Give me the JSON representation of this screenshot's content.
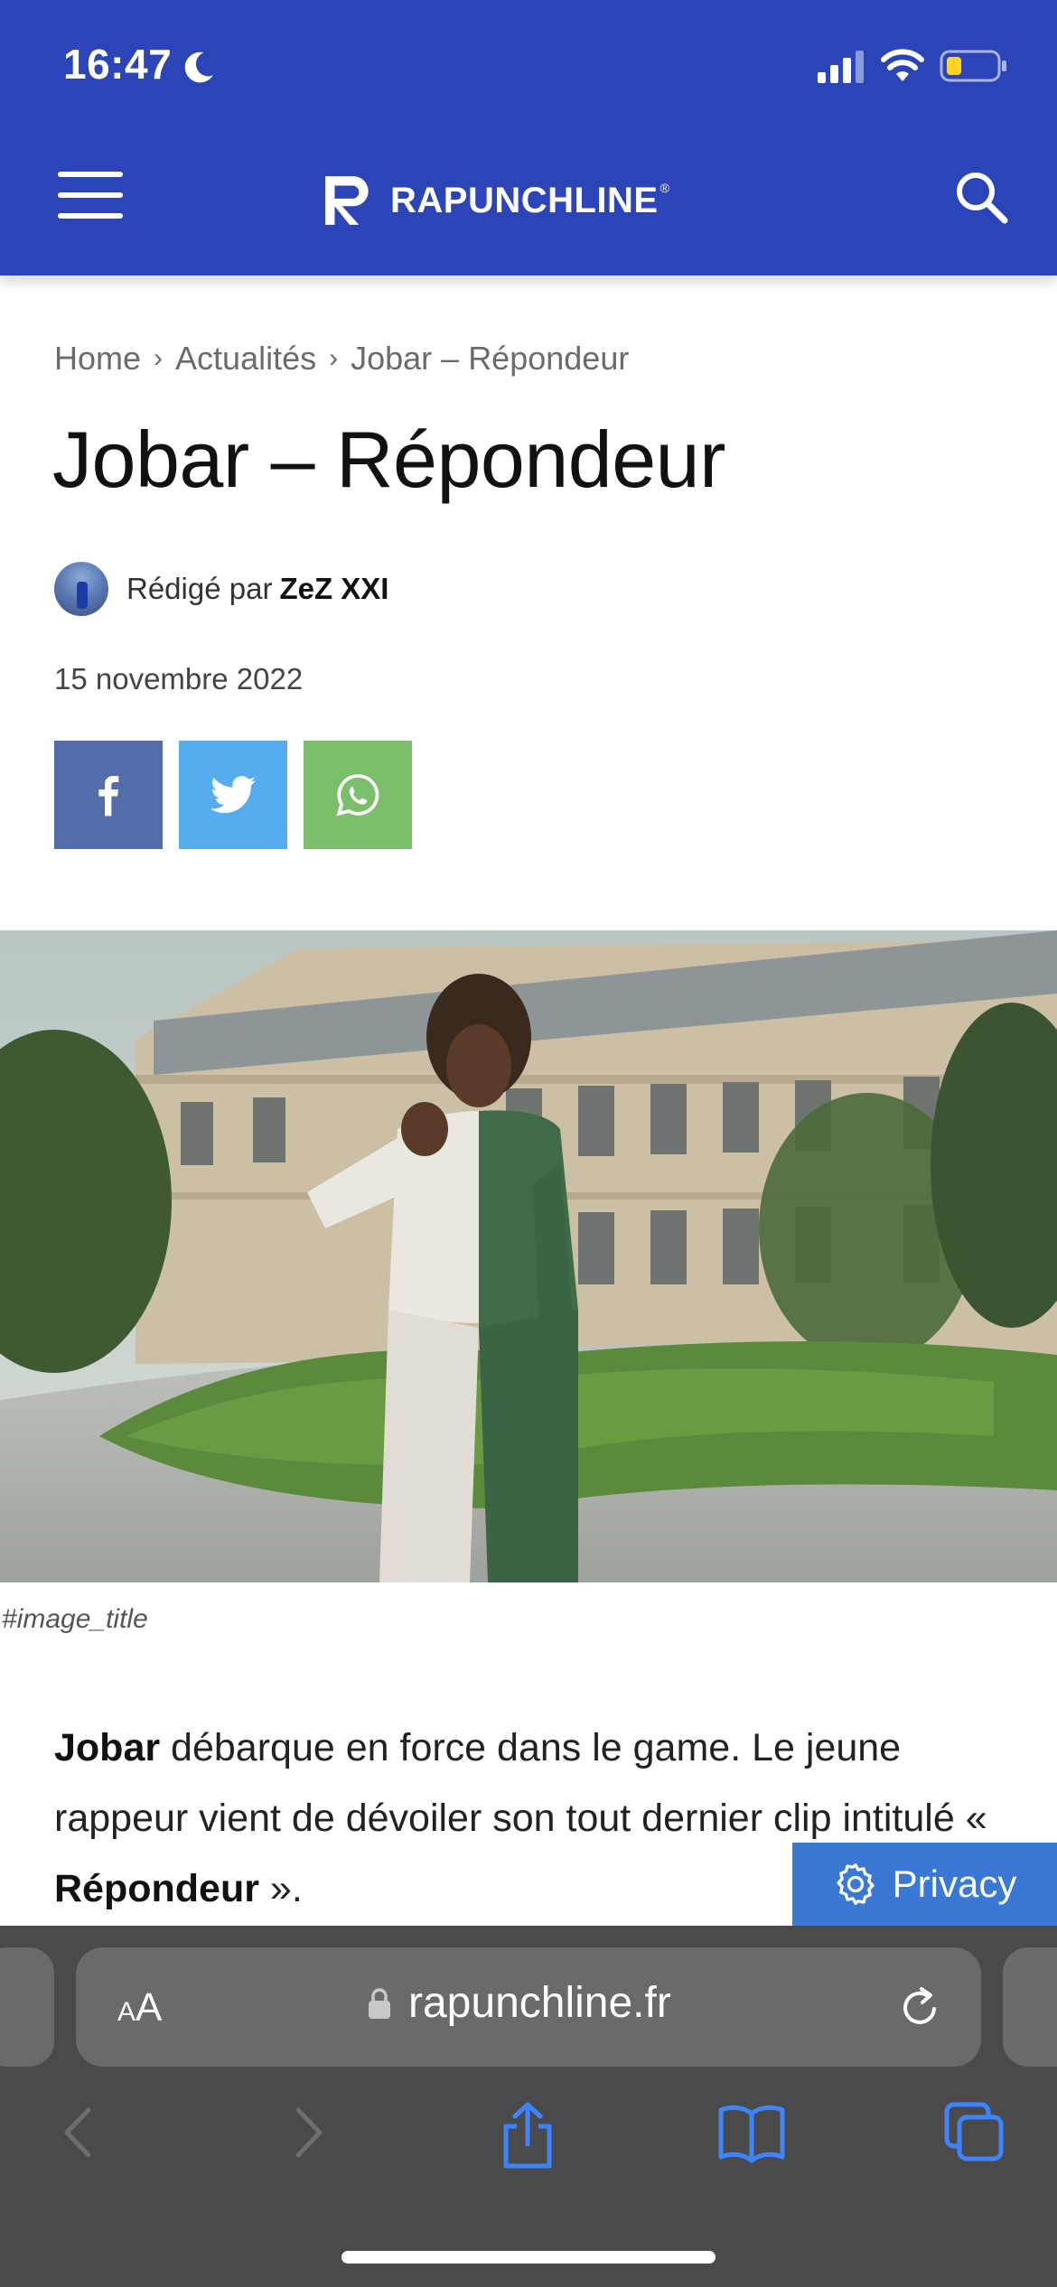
{
  "status": {
    "time": "16:47"
  },
  "site": {
    "logo_text": "RAPUNCHLINE",
    "logo_reg": "®"
  },
  "breadcrumb": {
    "items": [
      "Home",
      "Actualités",
      "Jobar – Répondeur"
    ],
    "separator": "›"
  },
  "article": {
    "title": "Jobar – Répondeur",
    "author_prefix": "Rédigé par",
    "author_name": "ZeZ XXI",
    "date": "15 novembre 2022",
    "image_caption": "#image_title",
    "body": {
      "artist": "Jobar",
      "text1": " débarque en force dans le game. Le jeune rappeur vient de dévoiler son tout dernier clip intitulé « ",
      "song": "Répondeur",
      "text2": " »."
    }
  },
  "share": {
    "facebook_icon": "facebook-icon",
    "twitter_icon": "twitter-icon",
    "whatsapp_icon": "whatsapp-icon",
    "colors": {
      "facebook": "#516eab",
      "twitter": "#55acee",
      "whatsapp": "#7bbf6a"
    }
  },
  "privacy": {
    "label": "Privacy"
  },
  "browser": {
    "aa_small": "A",
    "aa_large": "A",
    "url": "rapunchline.fr"
  },
  "colors": {
    "header": "#2b45b8",
    "browser": "#4a4a4c",
    "accent": "#3a78d6"
  }
}
